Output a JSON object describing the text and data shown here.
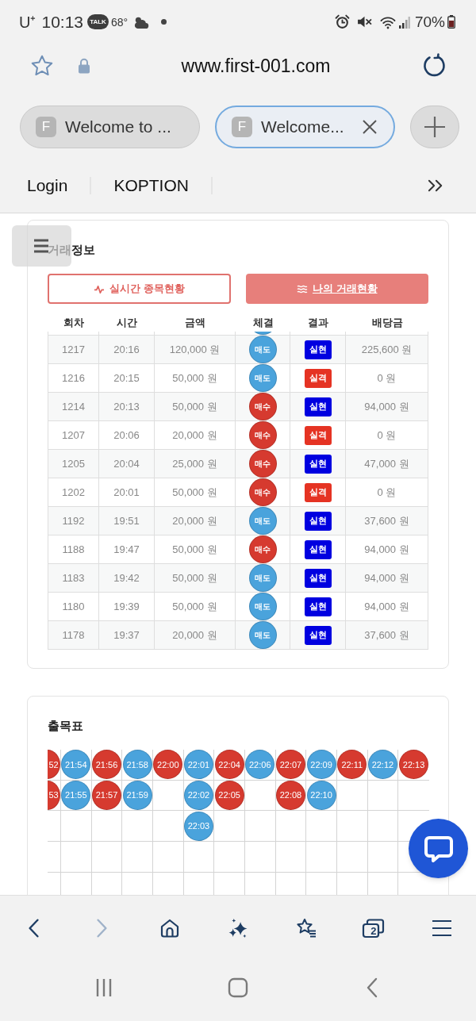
{
  "status_bar": {
    "carrier": "U⁺",
    "time": "10:13",
    "talk": "TALK",
    "temperature": "68°",
    "battery": "70%"
  },
  "address_bar": {
    "url": "www.first-001.com"
  },
  "tabs": [
    {
      "favicon": "F",
      "title": "Welcome to ...",
      "selected": false
    },
    {
      "favicon": "F",
      "title": "Welcome...",
      "selected": true
    }
  ],
  "bookmarks": [
    {
      "label": "Login"
    },
    {
      "label": "KOPTION"
    }
  ],
  "trade_info": {
    "title": "거래정보",
    "buttons": [
      {
        "kind": "pulse",
        "label": "실시간 종목현황",
        "selected": false
      },
      {
        "kind": "list",
        "label": "나의 거래현황",
        "selected": true
      }
    ],
    "columns": [
      "회차",
      "시간",
      "금액",
      "체결",
      "결과",
      "배당금"
    ],
    "rows": [
      {
        "round": "1217",
        "time": "20:16",
        "amount": "120,000 원",
        "side": {
          "label": "매도",
          "color": "#4aa3dc"
        },
        "result": {
          "label": "실현",
          "color": "#0000e0"
        },
        "payout": "225,600 원"
      },
      {
        "round": "1216",
        "time": "20:15",
        "amount": "50,000 원",
        "side": {
          "label": "매도",
          "color": "#4aa3dc"
        },
        "result": {
          "label": "실격",
          "color": "#e53323"
        },
        "payout": "0 원"
      },
      {
        "round": "1214",
        "time": "20:13",
        "amount": "50,000 원",
        "side": {
          "label": "매수",
          "color": "#d63a2f"
        },
        "result": {
          "label": "실현",
          "color": "#0000e0"
        },
        "payout": "94,000 원"
      },
      {
        "round": "1207",
        "time": "20:06",
        "amount": "20,000 원",
        "side": {
          "label": "매수",
          "color": "#d63a2f"
        },
        "result": {
          "label": "실격",
          "color": "#e53323"
        },
        "payout": "0 원"
      },
      {
        "round": "1205",
        "time": "20:04",
        "amount": "25,000 원",
        "side": {
          "label": "매수",
          "color": "#d63a2f"
        },
        "result": {
          "label": "실현",
          "color": "#0000e0"
        },
        "payout": "47,000 원"
      },
      {
        "round": "1202",
        "time": "20:01",
        "amount": "50,000 원",
        "side": {
          "label": "매수",
          "color": "#d63a2f"
        },
        "result": {
          "label": "실격",
          "color": "#e53323"
        },
        "payout": "0 원"
      },
      {
        "round": "1192",
        "time": "19:51",
        "amount": "20,000 원",
        "side": {
          "label": "매도",
          "color": "#4aa3dc"
        },
        "result": {
          "label": "실현",
          "color": "#0000e0"
        },
        "payout": "37,600 원"
      },
      {
        "round": "1188",
        "time": "19:47",
        "amount": "50,000 원",
        "side": {
          "label": "매수",
          "color": "#d63a2f"
        },
        "result": {
          "label": "실현",
          "color": "#0000e0"
        },
        "payout": "94,000 원"
      },
      {
        "round": "1183",
        "time": "19:42",
        "amount": "50,000 원",
        "side": {
          "label": "매도",
          "color": "#4aa3dc"
        },
        "result": {
          "label": "실현",
          "color": "#0000e0"
        },
        "payout": "94,000 원"
      },
      {
        "round": "1180",
        "time": "19:39",
        "amount": "50,000 원",
        "side": {
          "label": "매도",
          "color": "#4aa3dc"
        },
        "result": {
          "label": "실현",
          "color": "#0000e0"
        },
        "payout": "94,000 원"
      },
      {
        "round": "1178",
        "time": "19:37",
        "amount": "20,000 원",
        "side": {
          "label": "매도",
          "color": "#4aa3dc"
        },
        "result": {
          "label": "실현",
          "color": "#0000e0"
        },
        "payout": "37,600 원"
      }
    ]
  },
  "result_board": {
    "title": "출목표",
    "columns": [
      {
        "marks": [
          {
            "label": "52",
            "color": "#d63a2f"
          },
          {
            "label": "53",
            "color": "#d63a2f"
          }
        ]
      },
      {
        "marks": [
          {
            "label": "21:54",
            "color": "#4aa3dc"
          },
          {
            "label": "21:55",
            "color": "#4aa3dc"
          }
        ]
      },
      {
        "marks": [
          {
            "label": "21:56",
            "color": "#d63a2f"
          },
          {
            "label": "21:57",
            "color": "#d63a2f"
          }
        ]
      },
      {
        "marks": [
          {
            "label": "21:58",
            "color": "#4aa3dc"
          },
          {
            "label": "21:59",
            "color": "#4aa3dc"
          }
        ]
      },
      {
        "marks": [
          {
            "label": "22:00",
            "color": "#d63a2f"
          }
        ]
      },
      {
        "marks": [
          {
            "label": "22:01",
            "color": "#4aa3dc"
          },
          {
            "label": "22:02",
            "color": "#4aa3dc"
          },
          {
            "label": "22:03",
            "color": "#4aa3dc"
          }
        ]
      },
      {
        "marks": [
          {
            "label": "22:04",
            "color": "#d63a2f"
          },
          {
            "label": "22:05",
            "color": "#d63a2f"
          }
        ]
      },
      {
        "marks": [
          {
            "label": "22:06",
            "color": "#4aa3dc"
          }
        ]
      },
      {
        "marks": [
          {
            "label": "22:07",
            "color": "#d63a2f"
          },
          {
            "label": "22:08",
            "color": "#d63a2f"
          }
        ]
      },
      {
        "marks": [
          {
            "label": "22:09",
            "color": "#4aa3dc"
          },
          {
            "label": "22:10",
            "color": "#4aa3dc"
          }
        ]
      },
      {
        "marks": [
          {
            "label": "22:11",
            "color": "#d63a2f"
          }
        ]
      },
      {
        "marks": [
          {
            "label": "22:12",
            "color": "#4aa3dc"
          }
        ]
      },
      {
        "marks": [
          {
            "label": "22:13",
            "color": "#d63a2f"
          }
        ]
      }
    ]
  },
  "browser_toolbar": {
    "items": [
      {
        "kind": "back",
        "disabled": false
      },
      {
        "kind": "forward",
        "disabled": true
      },
      {
        "kind": "home",
        "disabled": false
      },
      {
        "kind": "assistant",
        "disabled": false
      },
      {
        "kind": "bookmarks",
        "disabled": false
      },
      {
        "kind": "tabs",
        "disabled": false,
        "count": "2"
      },
      {
        "kind": "menu",
        "disabled": false
      }
    ]
  }
}
